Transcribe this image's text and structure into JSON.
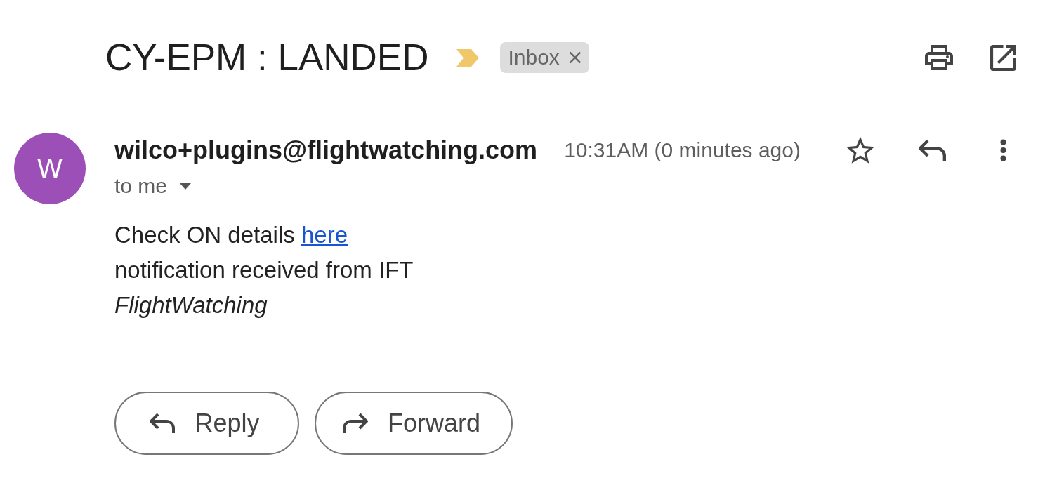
{
  "subject": {
    "title": "CY-EPM : LANDED",
    "important": true,
    "labels": [
      {
        "name": "Inbox"
      }
    ]
  },
  "message": {
    "avatar_letter": "W",
    "sender": "wilco+plugins@flightwatching.com",
    "time": "10:31AM (0 minutes ago)",
    "starred": false,
    "recipient": "to me",
    "body": [
      {
        "kind": "text",
        "text": "Check ON details",
        "link": "here"
      },
      {
        "kind": "text",
        "text": "notification received from IFT"
      },
      {
        "kind": "signature",
        "text": "FlightWatching"
      }
    ]
  },
  "actions": [
    {
      "kind": "reply",
      "label": "Reply"
    },
    {
      "kind": "forward",
      "label": "Forward"
    }
  ]
}
